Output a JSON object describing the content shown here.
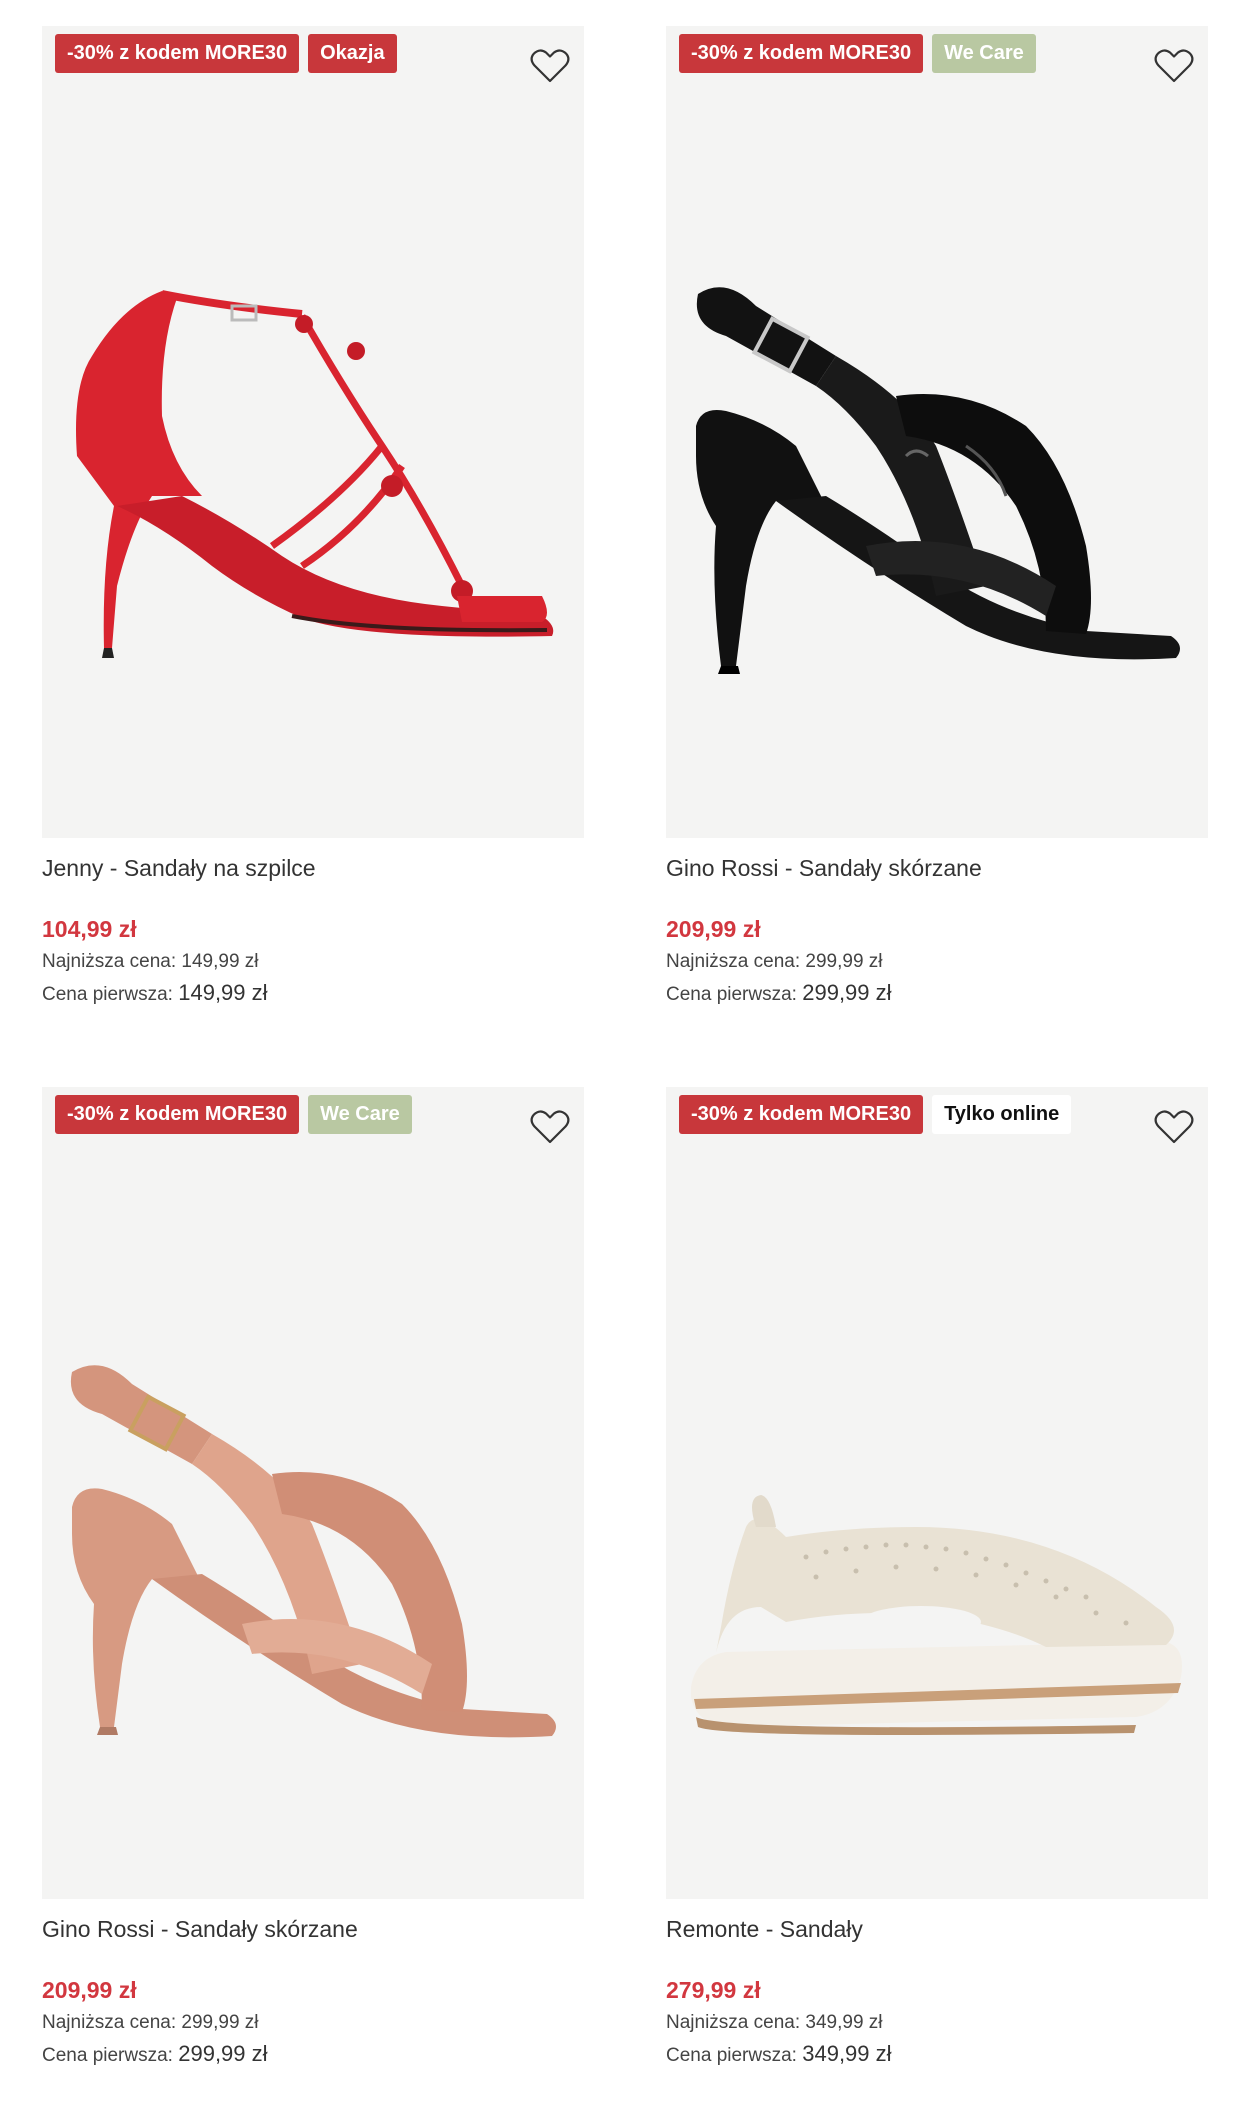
{
  "products": [
    {
      "name": "Jenny - Sandały na szpilce",
      "price": "104,99 zł",
      "lowest_label": "Najniższa cena:",
      "lowest_value": "149,99 zł",
      "first_label": "Cena pierwsza:",
      "first_value": "149,99 zł",
      "badges": [
        {
          "text": "-30% z kodem MORE30",
          "style": "red"
        },
        {
          "text": "Okazja",
          "style": "red"
        }
      ],
      "image": "red-stiletto-sandal",
      "shoe_color": "#d9242f"
    },
    {
      "name": "Gino Rossi - Sandały skórzane",
      "price": "209,99 zł",
      "lowest_label": "Najniższa cena:",
      "lowest_value": "299,99 zł",
      "first_label": "Cena pierwsza:",
      "first_value": "299,99 zł",
      "badges": [
        {
          "text": "-30% z kodem MORE30",
          "style": "red"
        },
        {
          "text": "We Care",
          "style": "green"
        }
      ],
      "image": "black-patent-sandal",
      "shoe_color": "#111111"
    },
    {
      "name": "Gino Rossi - Sandały skórzane",
      "price": "209,99 zł",
      "lowest_label": "Najniższa cena:",
      "lowest_value": "299,99 zł",
      "first_label": "Cena pierwsza:",
      "first_value": "299,99 zł",
      "badges": [
        {
          "text": "-30% z kodem MORE30",
          "style": "red"
        },
        {
          "text": "We Care",
          "style": "green"
        }
      ],
      "image": "nude-patent-sandal",
      "shoe_color": "#d79a82"
    },
    {
      "name": "Remonte - Sandały",
      "price": "279,99 zł",
      "lowest_label": "Najniższa cena:",
      "lowest_value": "349,99 zł",
      "first_label": "Cena pierwsza:",
      "first_value": "349,99 zł",
      "badges": [
        {
          "text": "-30% z kodem MORE30",
          "style": "red"
        },
        {
          "text": "Tylko online",
          "style": "white"
        }
      ],
      "image": "beige-wedge-sandal",
      "shoe_color": "#e6e0d4"
    }
  ],
  "colors": {
    "badge_red": "#c8373b",
    "badge_green": "#b9c8a2",
    "price_red": "#d2373f",
    "image_bg": "#f4f4f3"
  },
  "icons": {
    "wishlist": "heart-outline-icon"
  }
}
